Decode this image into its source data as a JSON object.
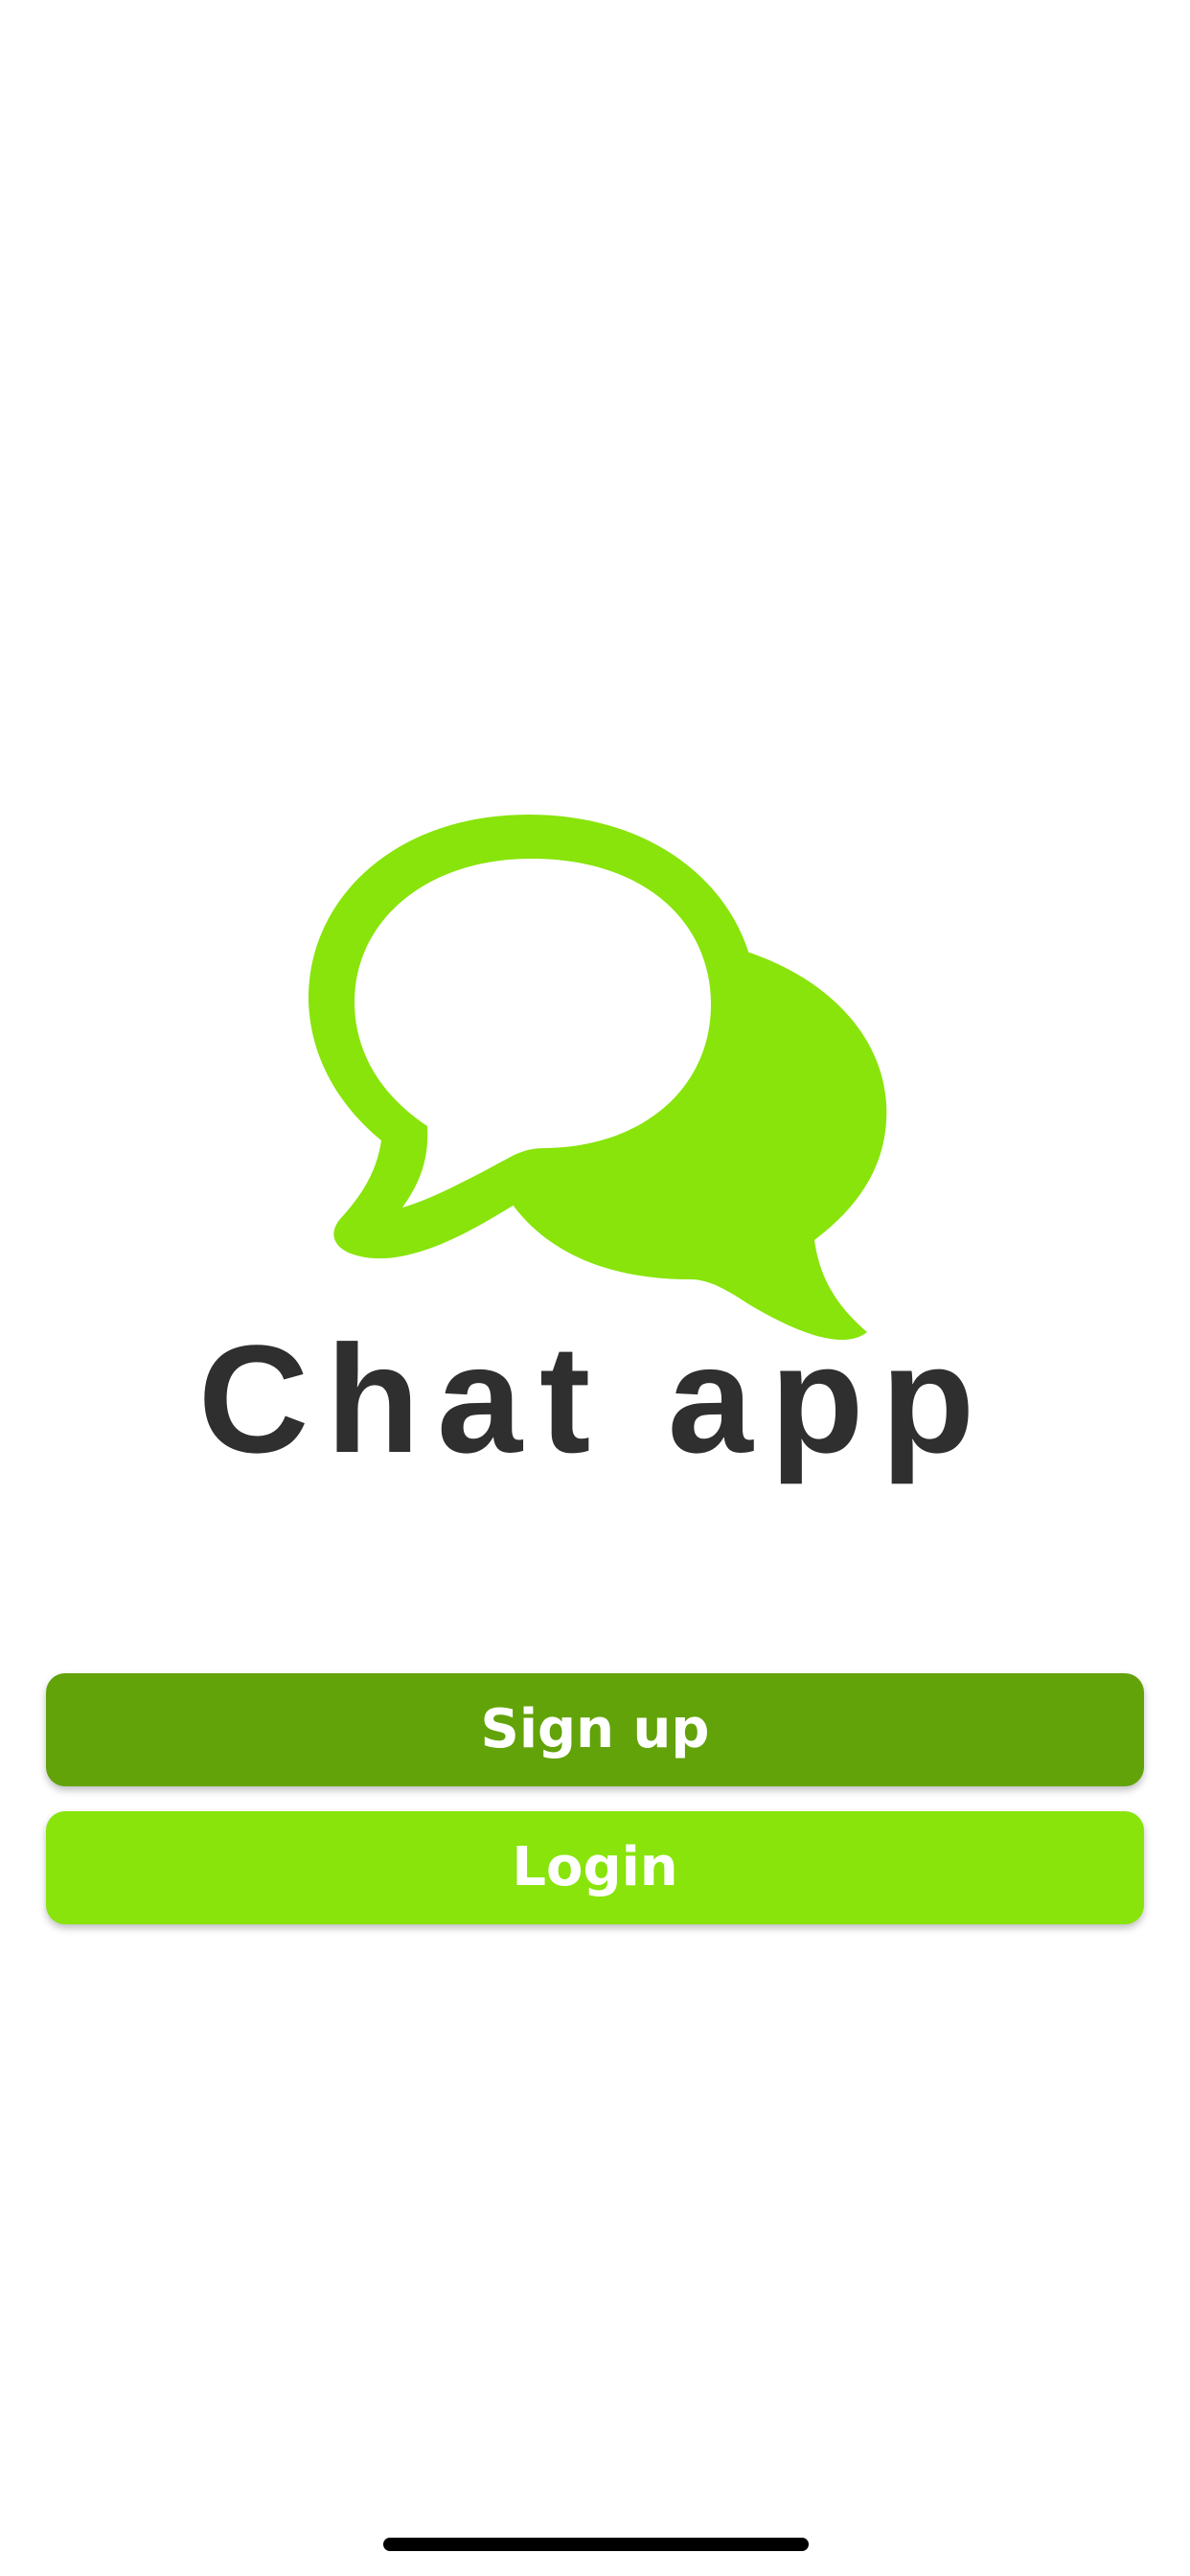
{
  "app": {
    "logo": {
      "icon": "chat-bubbles-icon",
      "text": "Chat app",
      "accent_color": "#88e40a",
      "text_color": "#2f2f2f"
    },
    "buttons": {
      "signup_label": "Sign up",
      "signup_color": "#61a308",
      "login_label": "Login",
      "login_color": "#88e40a"
    }
  }
}
